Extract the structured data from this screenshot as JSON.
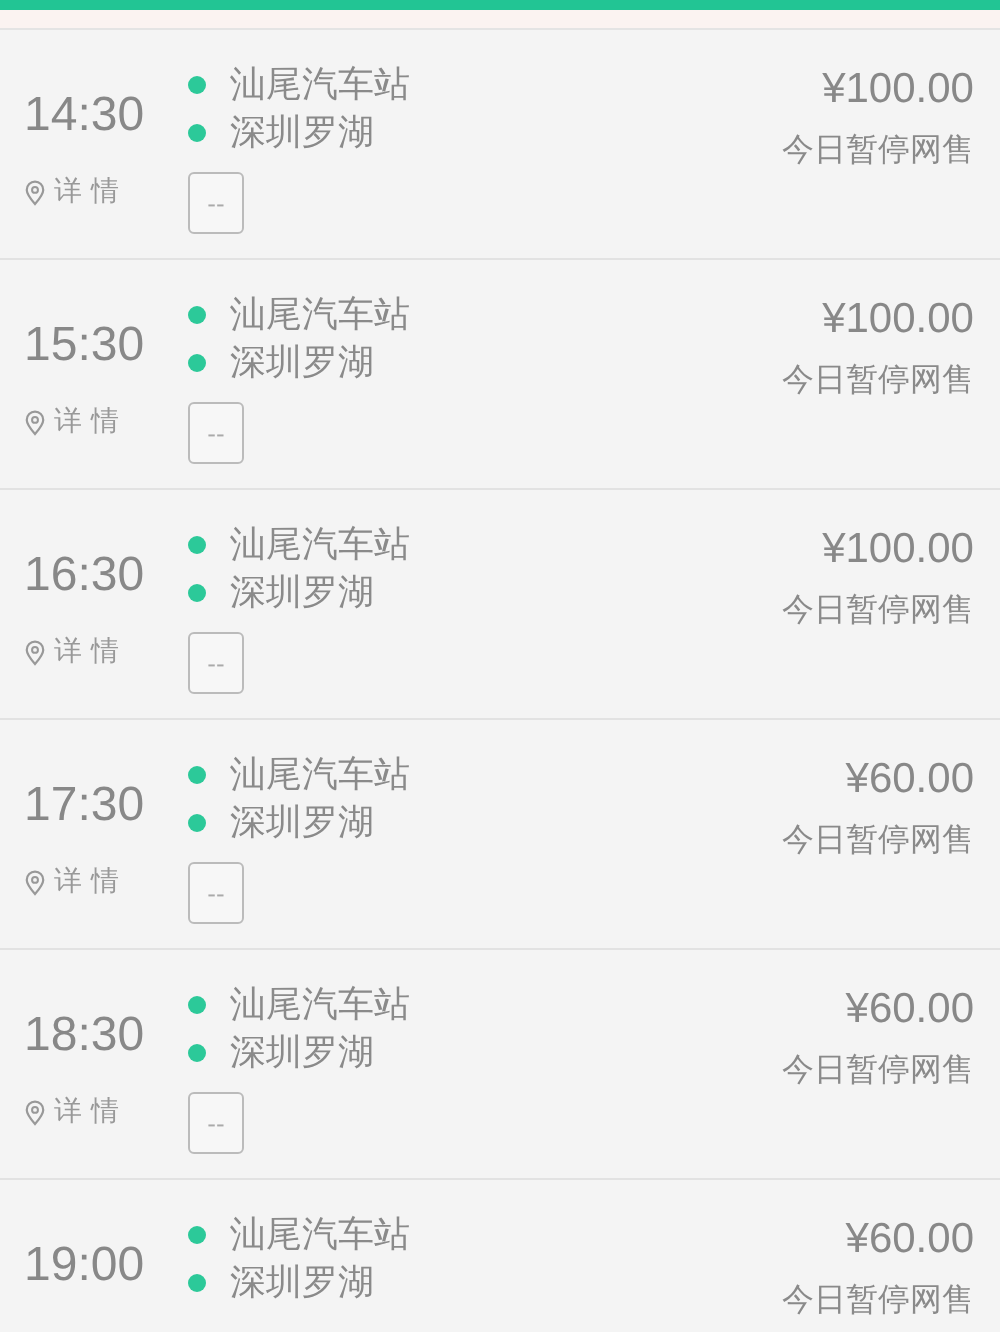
{
  "trips": [
    {
      "time": "14:30",
      "stops": [
        "汕尾汽车站",
        "深圳罗湖"
      ],
      "price": "¥100.00",
      "status": "今日暂停网售",
      "detail": "详 情",
      "seat": "--"
    },
    {
      "time": "15:30",
      "stops": [
        "汕尾汽车站",
        "深圳罗湖"
      ],
      "price": "¥100.00",
      "status": "今日暂停网售",
      "detail": "详 情",
      "seat": "--"
    },
    {
      "time": "16:30",
      "stops": [
        "汕尾汽车站",
        "深圳罗湖"
      ],
      "price": "¥100.00",
      "status": "今日暂停网售",
      "detail": "详 情",
      "seat": "--"
    },
    {
      "time": "17:30",
      "stops": [
        "汕尾汽车站",
        "深圳罗湖"
      ],
      "price": "¥60.00",
      "status": "今日暂停网售",
      "detail": "详 情",
      "seat": "--"
    },
    {
      "time": "18:30",
      "stops": [
        "汕尾汽车站",
        "深圳罗湖"
      ],
      "price": "¥60.00",
      "status": "今日暂停网售",
      "detail": "详 情",
      "seat": "--"
    },
    {
      "time": "19:00",
      "stops": [
        "汕尾汽车站",
        "深圳罗湖"
      ],
      "price": "¥60.00",
      "status": "今日暂停网售"
    }
  ]
}
